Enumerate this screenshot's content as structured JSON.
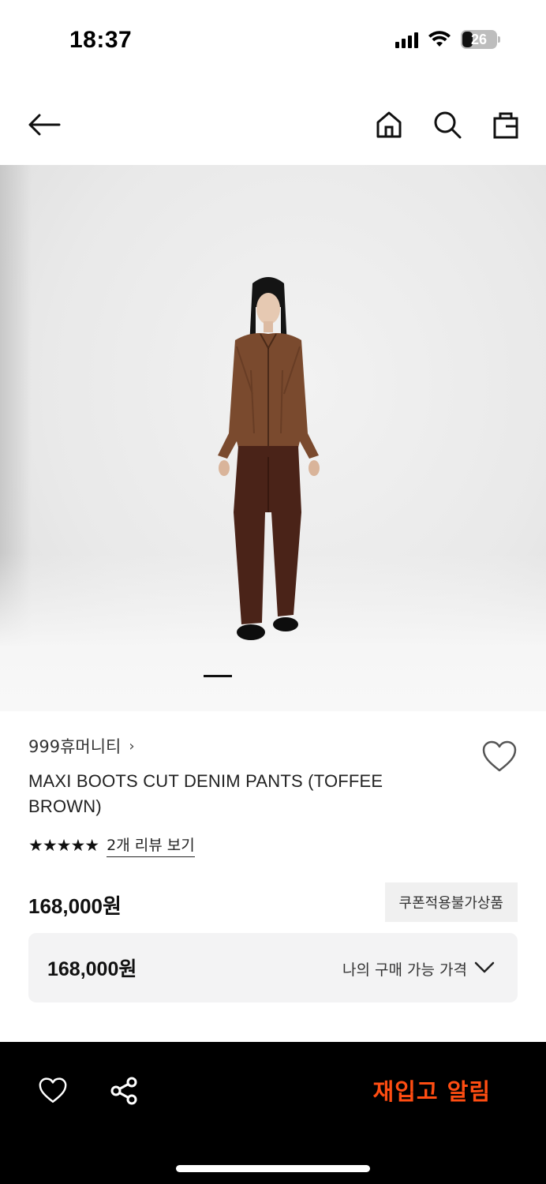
{
  "status_bar": {
    "time": "18:37",
    "battery_level": "26",
    "icons": [
      "cellular-signal-icon",
      "wifi-icon",
      "battery-icon"
    ]
  },
  "nav": {
    "icons": [
      "back-arrow-icon",
      "home-icon",
      "search-icon",
      "shopping-bag-icon"
    ]
  },
  "hero": {
    "image_count_indicator": "page-indicator"
  },
  "product": {
    "brand": "999휴머니티",
    "brand_chevron": "›",
    "title": "MAXI BOOTS CUT DENIM PANTS (TOFFEE BROWN)",
    "stars": "★★★★★",
    "rating": 5,
    "review_link": "2개 리뷰 보기",
    "price": "168,000원",
    "coupon_badge": "쿠폰적용불가상품"
  },
  "my_price": {
    "value": "168,000원",
    "label": "나의 구매 가능 가격"
  },
  "bottom_bar": {
    "restock_label": "재입고 알림",
    "accent_color": "#ff4d12",
    "icons": [
      "heart-icon",
      "share-icon"
    ]
  }
}
